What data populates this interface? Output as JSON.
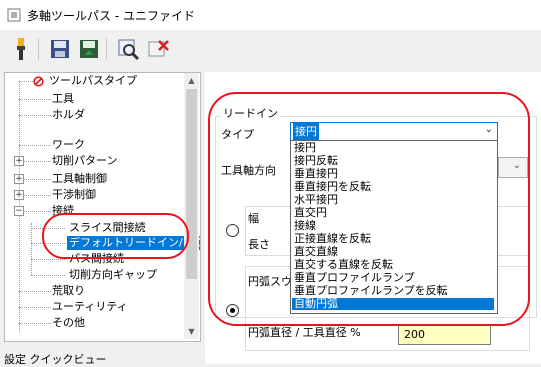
{
  "window": {
    "title": "多軸ツールパス - ユニファイド"
  },
  "toolbar": {
    "buttons": [
      "tool-icon",
      "save-icon",
      "save-green-icon",
      "preview-icon",
      "delete-icon"
    ]
  },
  "tree": {
    "items": [
      {
        "label": "ツールパスタイプ"
      },
      {
        "label": "工具"
      },
      {
        "label": "ホルダ"
      },
      {
        "label": "ワーク"
      },
      {
        "label": "切削パターン"
      },
      {
        "label": "工具軸制御"
      },
      {
        "label": "干渉制御"
      },
      {
        "label": "接続"
      },
      {
        "label": "スライス間接続"
      },
      {
        "label": "デフォルトリードイン/アウ"
      },
      {
        "label": "パス間接続"
      },
      {
        "label": "切削方向ギャップ"
      },
      {
        "label": "荒取り"
      },
      {
        "label": "ユーティリティ"
      },
      {
        "label": "その他"
      }
    ],
    "footer": "設定 クイックビュー"
  },
  "main": {
    "group_title": "リードイン",
    "type_label": "タイプ",
    "type_value": "接円",
    "tool_axis_label": "工具軸方向",
    "width_label": "幅",
    "length_label": "長さ",
    "arc_label": "円弧スウ",
    "diameter_label": "円弧直径 / 工具直径 %",
    "diameter_value": "200"
  },
  "dropdown": {
    "options": [
      "接円",
      "接円反転",
      "垂直接円",
      "垂直接円を反転",
      "水平接円",
      "直交円",
      "接線",
      "正接直線を反転",
      "直交直線",
      "直交する直線を反転",
      "垂直プロファイルランプ",
      "垂直プロファイルランプを反転",
      "自動円弧"
    ],
    "selected": "自動円弧"
  },
  "colors": {
    "highlight": "#0078d7",
    "annotation": "#e8141e",
    "input_bg": "#ffffc0"
  }
}
